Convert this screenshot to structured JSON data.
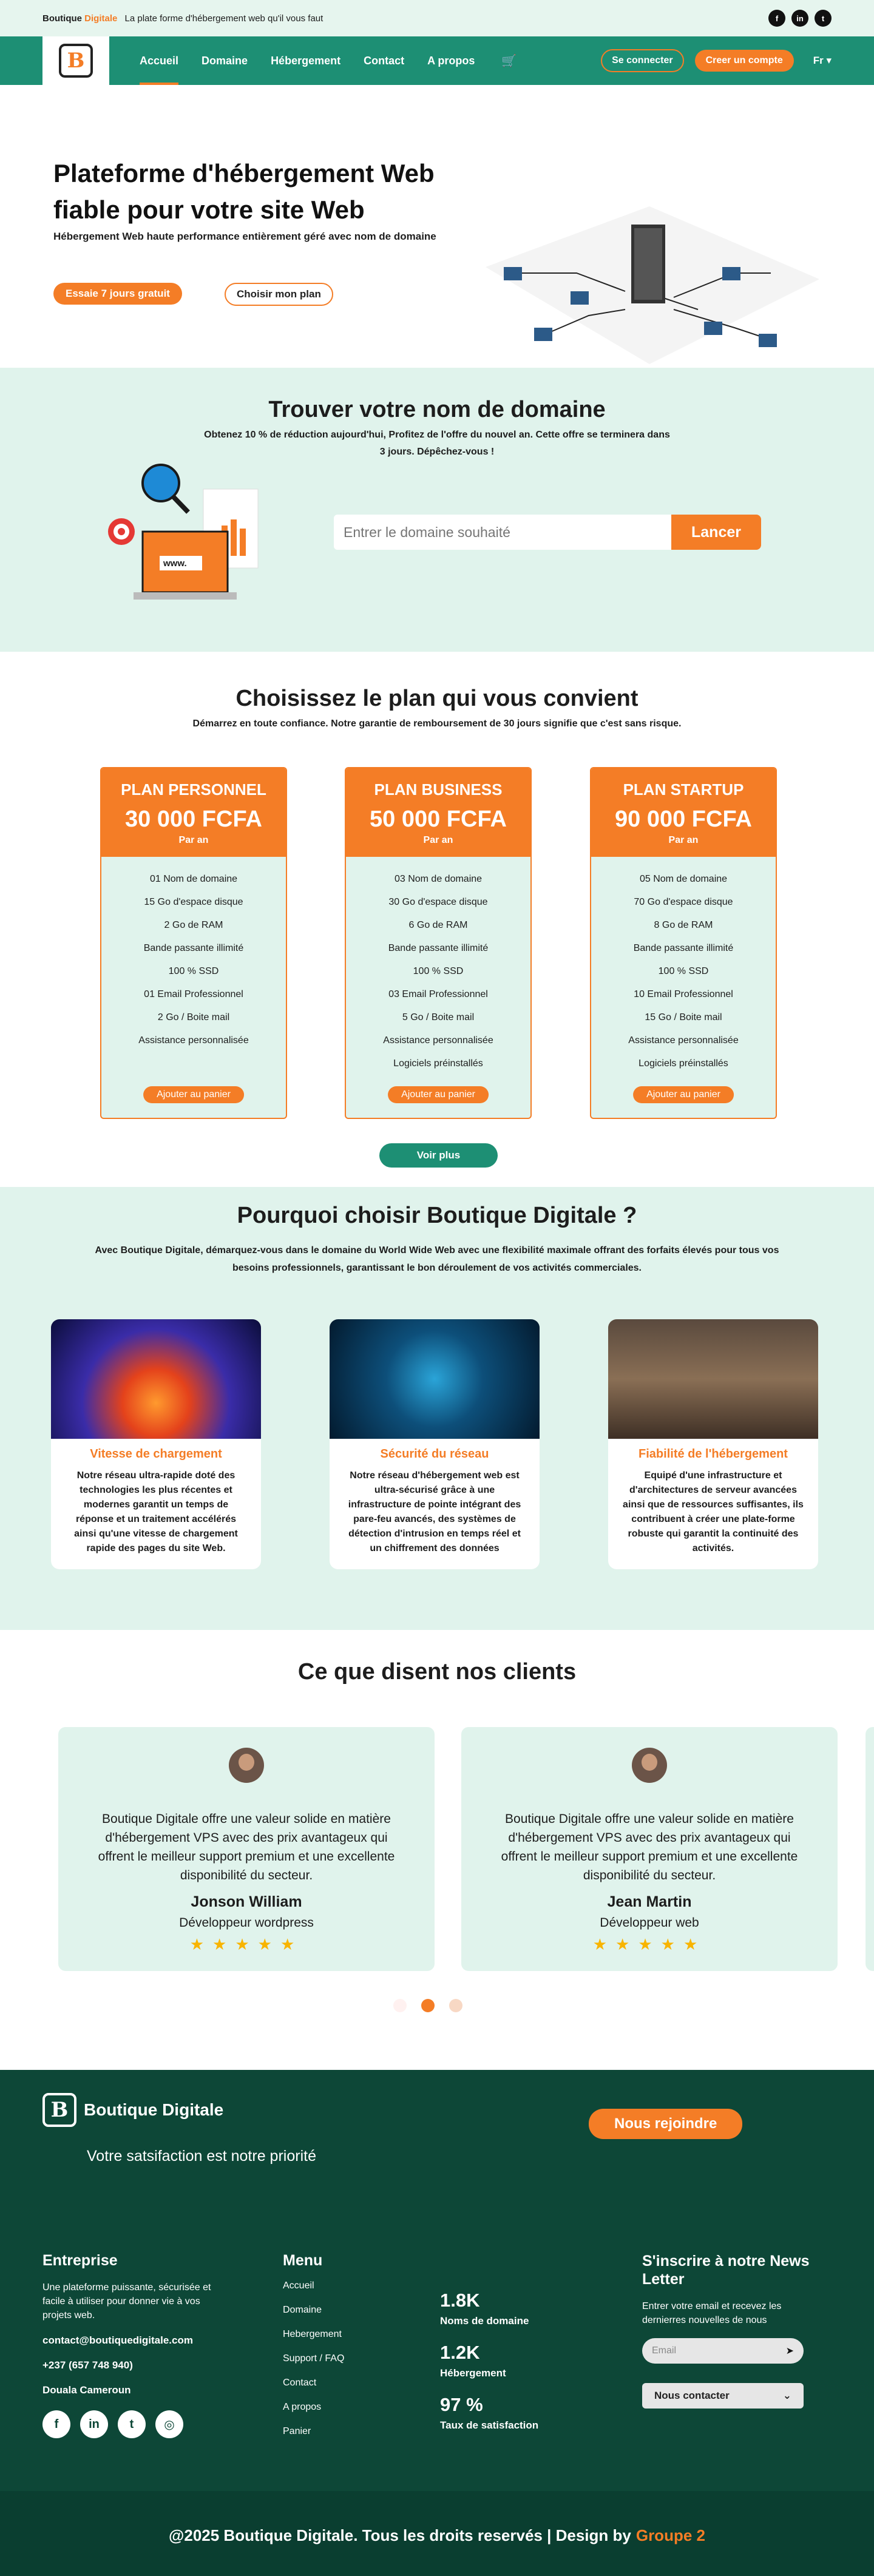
{
  "topbar": {
    "brand_a": "Boutique",
    "brand_b": "Digitale",
    "tagline": "La plate forme d'hébergement web qu'il vous faut",
    "socials": [
      "facebook-icon",
      "linkedin-icon",
      "twitter-icon"
    ],
    "social_glyphs": [
      "f",
      "in",
      "t"
    ]
  },
  "nav": {
    "logo_letter": "B",
    "links": [
      "Accueil",
      "Domaine",
      "Hébergement",
      "Contact",
      "A propos"
    ],
    "login": "Se connecter",
    "signup": "Creer un compte",
    "lang": "Fr ▾",
    "cart_glyph": "🛒"
  },
  "hero": {
    "title": "Plateforme d'hébergement Web fiable pour votre site Web",
    "subtitle": "Hébergement Web haute performance entièrement géré avec nom de domaine",
    "btn_trial": "Essaie 7 jours gratuit",
    "btn_plan": "Choisir mon plan"
  },
  "domain": {
    "title": "Trouver votre nom de domaine",
    "subtitle": "Obtenez 10 % de réduction aujourd'hui, Profitez de l'offre du nouvel an. Cette offre se terminera dans 3 jours. Dépêchez-vous !",
    "placeholder": "Entrer le domaine souhaité",
    "button": "Lancer",
    "ill_text": "www."
  },
  "plans": {
    "title": "Choisissez le plan qui vous convient",
    "subtitle": "Démarrez en toute confiance. Notre garantie de remboursement de 30 jours signifie que c'est sans risque.",
    "per": "Par an",
    "add": "Ajouter au panier",
    "more": "Voir plus",
    "items": [
      {
        "name": "PLAN PERSONNEL",
        "price": "30 000 FCFA",
        "features": [
          "01 Nom de domaine",
          "15 Go d'espace disque",
          "2 Go de RAM",
          "Bande passante illimité",
          "100 % SSD",
          "01 Email Professionnel",
          "2 Go / Boite mail",
          "Assistance personnalisée"
        ]
      },
      {
        "name": "PLAN BUSINESS",
        "price": "50 000 FCFA",
        "features": [
          "03 Nom de domaine",
          "30 Go d'espace disque",
          "6 Go de RAM",
          "Bande passante illimité",
          "100 % SSD",
          "03 Email Professionnel",
          "5 Go / Boite mail",
          "Assistance personnalisée",
          "Logiciels préinstallés"
        ]
      },
      {
        "name": "PLAN STARTUP",
        "price": "90 000 FCFA",
        "features": [
          "05 Nom de domaine",
          "70 Go d'espace disque",
          "8 Go de RAM",
          "Bande passante illimité",
          "100 % SSD",
          "10 Email Professionnel",
          "15 Go / Boite mail",
          "Assistance personnalisée",
          "Logiciels préinstallés"
        ]
      }
    ]
  },
  "why": {
    "title": "Pourquoi choisir Boutique Digitale ?",
    "subtitle": "Avec Boutique Digitale, démarquez-vous dans le domaine du World Wide Web avec une flexibilité maximale offrant des forfaits élevés pour tous vos besoins professionnels, garantissant le bon déroulement de vos activités commerciales.",
    "cards": [
      {
        "title": "Vitesse de chargement",
        "text": "Notre réseau ultra-rapide doté des technologies les plus récentes et modernes garantit un temps de réponse et un traitement accélérés ainsi qu'une vitesse de chargement rapide des pages du site Web."
      },
      {
        "title": "Sécurité du réseau",
        "text": "Notre réseau d'hébergement web est ultra-sécurisé grâce à une infrastructure de pointe intégrant des pare-feu avancés, des systèmes de détection d'intrusion en temps réel et un chiffrement des données"
      },
      {
        "title": "Fiabilité de l'hébergement",
        "text": "Equipé d'une infrastructure et d'architectures de serveur avancées ainsi que de ressources suffisantes, ils contribuent à créer une plate-forme robuste qui garantit la continuité des activités."
      }
    ]
  },
  "testimonials": {
    "title": "Ce que disent nos clients",
    "stars": "★★★★★",
    "items": [
      {
        "text": "Boutique Digitale offre une valeur solide en matière d'hébergement VPS avec des prix avantageux qui offrent le meilleur support premium et une excellente disponibilité du secteur.",
        "name": "Jonson William",
        "role": "Développeur wordpress"
      },
      {
        "text": "Boutique Digitale offre une valeur solide en matière d'hébergement VPS avec des prix avantageux qui offrent le meilleur support premium et une excellente disponibilité du secteur.",
        "name": "Jean Martin",
        "role": "Développeur web"
      }
    ]
  },
  "footer": {
    "brand": "Boutique Digitale",
    "slogan": "Votre satsifaction est notre priorité",
    "join": "Nous rejoindre",
    "ent_title": "Entreprise",
    "ent_text": "Une plateforme puissante, sécurisée et facile à utiliser pour donner vie à vos projets web.",
    "email": "contact@boutiquedigitale.com",
    "phone": "+237 (657 748 940)",
    "city": "Douala Cameroun",
    "menu_title": "Menu",
    "menu": [
      "Accueil",
      "Domaine",
      "Hebergement",
      "Support / FAQ",
      "Contact",
      "A propos",
      "Panier"
    ],
    "stats": [
      {
        "value": "1.8K",
        "label": "Noms de domaine"
      },
      {
        "value": "1.2K",
        "label": "Hébergement"
      },
      {
        "value": "97 %",
        "label": "Taux de satisfaction"
      }
    ],
    "news_title": "S'inscrire à notre News Letter",
    "news_text": "Entrer votre email et recevez les dernierres nouvelles de nous",
    "news_placeholder": "Email",
    "contact_btn": "Nous contacter",
    "socials": [
      "f",
      "in",
      "t",
      "◎"
    ],
    "copyright": "@2025 Boutique Digitale. Tous les droits reservés | Design by",
    "design_by": "Groupe 2"
  },
  "colors": {
    "accent": "#f47d26",
    "primary": "#1d8f74",
    "light": "#e0f3ec",
    "footer": "#0d4737"
  }
}
